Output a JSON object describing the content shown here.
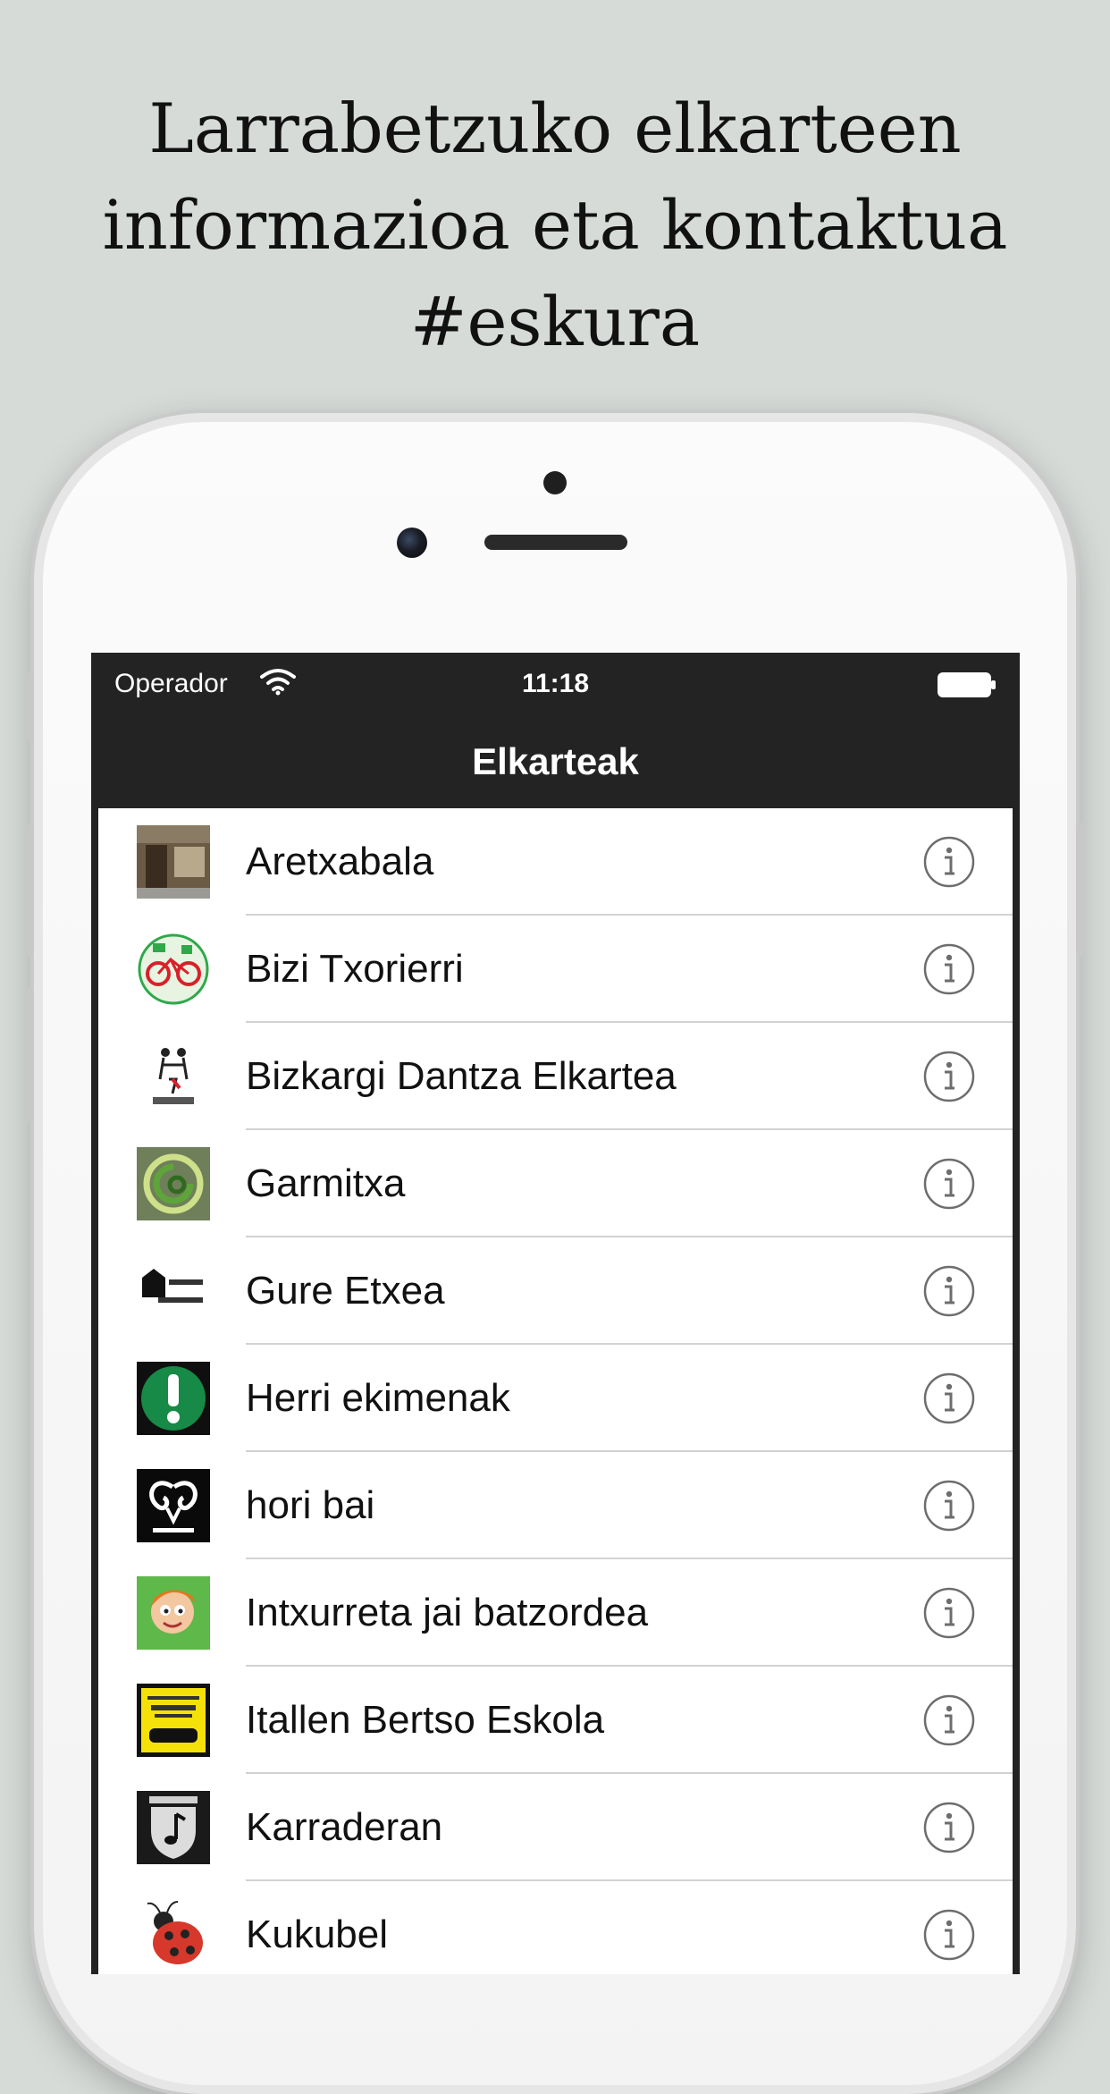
{
  "headline": {
    "line1": "Larrabetzuko elkarteen",
    "line2": "informazioa eta kontaktua",
    "line3": "#eskura"
  },
  "status_bar": {
    "carrier": "Operador",
    "time": "11:18"
  },
  "nav": {
    "title": "Elkarteak"
  },
  "rows": [
    {
      "label": "Aretxabala",
      "thumb": "photo-storefront"
    },
    {
      "label": "Bizi Txorierri",
      "thumb": "bicycle-logo"
    },
    {
      "label": "Bizkargi Dantza Elkartea",
      "thumb": "dancer-logo"
    },
    {
      "label": "Garmitxa",
      "thumb": "green-spiral-logo"
    },
    {
      "label": "Gure Etxea",
      "thumb": "gure-etxea-logo"
    },
    {
      "label": "Herri ekimenak",
      "thumb": "exclamation-logo"
    },
    {
      "label": "hori bai",
      "thumb": "ram-horns-logo"
    },
    {
      "label": "Intxurreta jai batzordea",
      "thumb": "cartoon-character"
    },
    {
      "label": "Itallen Bertso Eskola",
      "thumb": "bertso-eskola-logo"
    },
    {
      "label": "Karraderan",
      "thumb": "shield-note-logo"
    },
    {
      "label": "Kukubel",
      "thumb": "ladybug-logo"
    }
  ],
  "colors": {
    "background": "#d7dbd8",
    "nav_bar": "#232323",
    "info_icon": "#6d6d6d"
  },
  "icons": {
    "row_accessory": "info-icon",
    "status_wifi": "wifi-icon",
    "status_battery": "battery-icon"
  }
}
